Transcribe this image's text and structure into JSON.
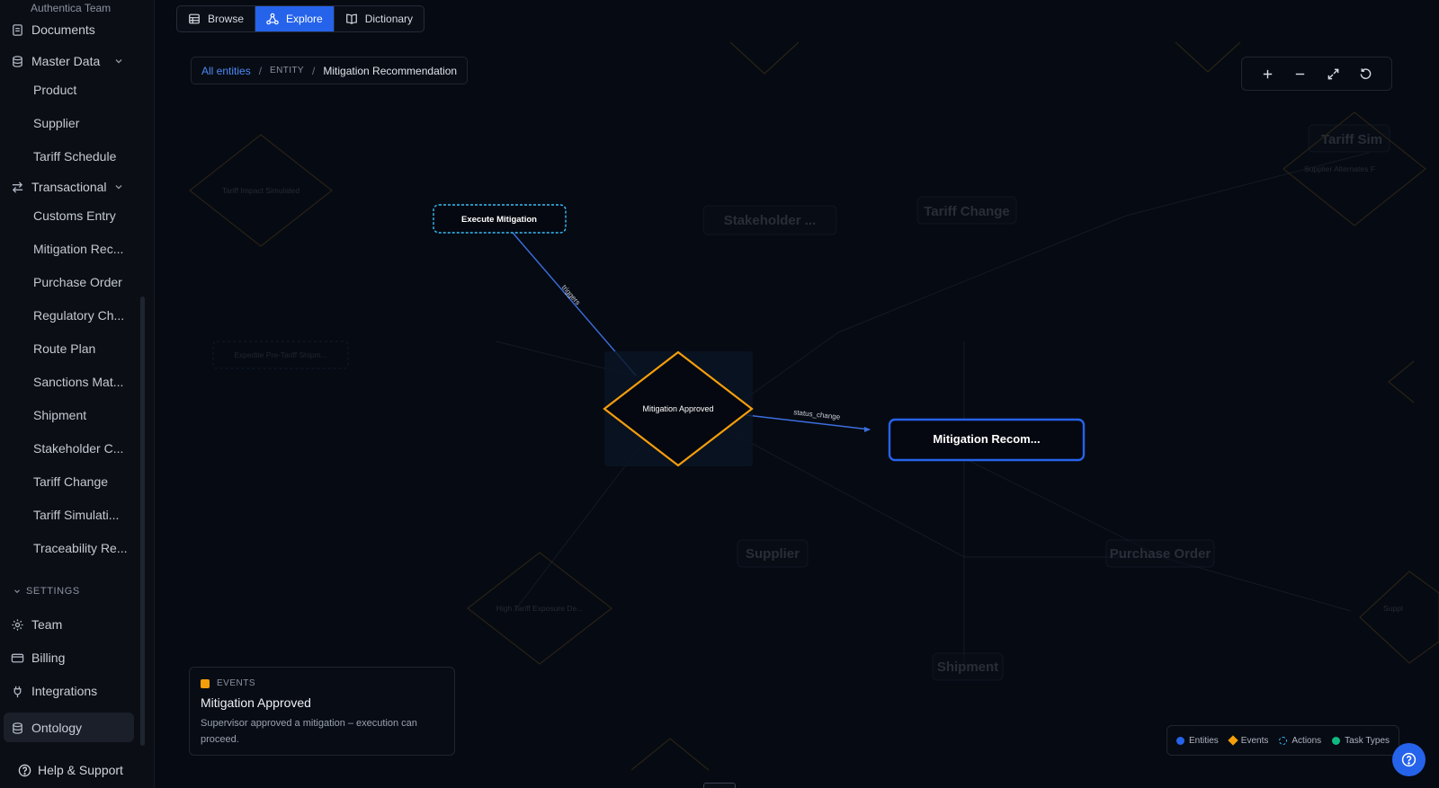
{
  "sidebar": {
    "team": "Authentica Team",
    "documents": "Documents",
    "master_data": {
      "label": "Master Data",
      "items": [
        "Product",
        "Supplier",
        "Tariff Schedule"
      ]
    },
    "transactional": {
      "label": "Transactional",
      "items": [
        "Customs Entry",
        "Mitigation Rec...",
        "Purchase Order",
        "Regulatory Ch...",
        "Route Plan",
        "Sanctions Mat...",
        "Shipment",
        "Stakeholder C...",
        "Tariff Change",
        "Tariff Simulati...",
        "Traceability Re..."
      ]
    },
    "settings_label": "SETTINGS",
    "settings": [
      "Team",
      "Billing",
      "Integrations",
      "Ontology"
    ],
    "help": "Help & Support"
  },
  "toolbar": {
    "browse": "Browse",
    "explore": "Explore",
    "dictionary": "Dictionary"
  },
  "breadcrumb": {
    "root": "All entities",
    "type": "ENTITY",
    "current": "Mitigation Recommendation"
  },
  "graph": {
    "active": {
      "action": "Execute Mitigation",
      "event": "Mitigation Approved",
      "entity": "Mitigation Recom...",
      "edge1": "triggers",
      "edge2": "status_change"
    },
    "faded": {
      "tariff_impact": "Tariff Impact Simulated",
      "expedite": "Expedite Pre-Tariff Shipm...",
      "stakeholder": "Stakeholder ...",
      "tariff_change": "Tariff Change",
      "tariff_sim": "Tariff Sim",
      "supplier_alt": "Supplier Alternates F",
      "supplier": "Supplier",
      "purchase_order": "Purchase Order",
      "high_tariff": "High Tariff Exposure De...",
      "shipment": "Shipment",
      "suppl": "Suppl"
    }
  },
  "info": {
    "tag": "EVENTS",
    "title": "Mitigation Approved",
    "description": "Supervisor approved a mitigation – execution can proceed."
  },
  "legend": {
    "entities": "Entities",
    "events": "Events",
    "actions": "Actions",
    "task_types": "Task Types"
  },
  "colors": {
    "accent": "#2563eb",
    "event": "#f59e0b",
    "action": "#38bdf8",
    "task_type": "#10b981"
  }
}
